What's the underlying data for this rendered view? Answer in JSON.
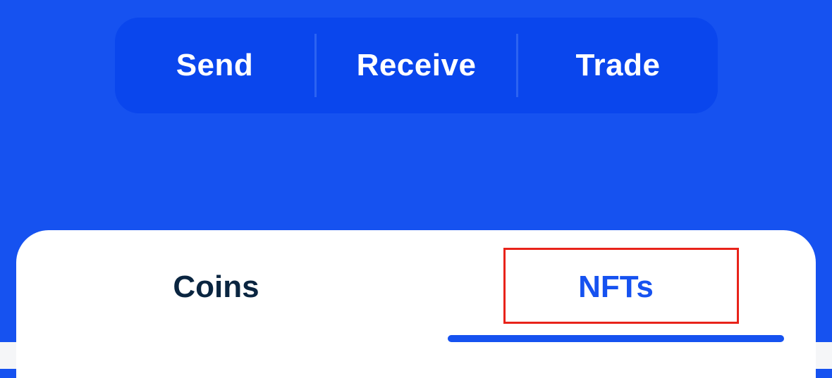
{
  "actions": {
    "send_label": "Send",
    "receive_label": "Receive",
    "trade_label": "Trade"
  },
  "tabs": [
    {
      "label": "Coins",
      "active": false
    },
    {
      "label": "NFTs",
      "active": true
    }
  ],
  "colors": {
    "background": "#1652f0",
    "action_bar": "#0a46ed",
    "tab_active": "#1652f0",
    "tab_inactive": "#0a2540",
    "highlight": "#e8231a"
  }
}
